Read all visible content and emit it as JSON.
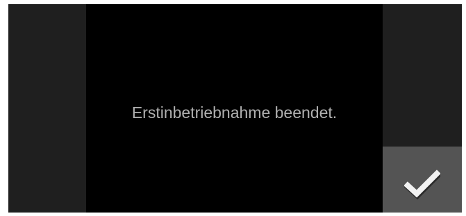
{
  "dialog": {
    "message": "Erstinbetriebnahme beendet.",
    "confirm_icon": "checkmark-icon"
  },
  "colors": {
    "background": "#000000",
    "side_panel": "#1f1f1f",
    "confirm_button": "#545454",
    "text": "#b0b0b0",
    "checkmark": "#f2f2f2"
  }
}
